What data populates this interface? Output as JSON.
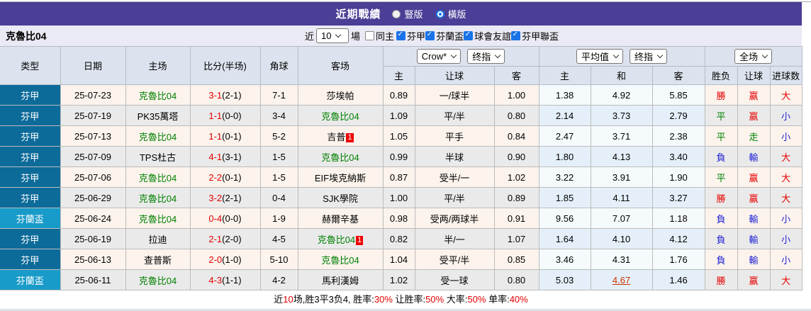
{
  "colors": {
    "accent_purple": "#4a3e96",
    "league_regular_bg": "#0d6b9a",
    "league_cup_bg": "#189bc9",
    "win_red": "#e60000",
    "draw_green": "#008000",
    "lose_blue": "#2121d6",
    "checkbox_blue": "#1a73e8"
  },
  "header": {
    "title": "近期戰績",
    "radio_options": [
      {
        "label": "豎版",
        "selected": false
      },
      {
        "label": "橫版",
        "selected": true
      }
    ]
  },
  "filter": {
    "team": "克魯比04",
    "near_label": "近",
    "count_value": "10",
    "games_label": "場",
    "same_home": {
      "label": "同主",
      "checked": false
    },
    "leagues": [
      {
        "label": "芬甲",
        "checked": true
      },
      {
        "label": "芬蘭盃",
        "checked": true
      },
      {
        "label": "球會友誼",
        "checked": true
      },
      {
        "label": "芬甲聯盃",
        "checked": true
      }
    ]
  },
  "table": {
    "top_headers": [
      "类型",
      "日期",
      "主场",
      "比分(半场)",
      "角球",
      "客场"
    ],
    "selects": {
      "company": "Crow*",
      "company_index": "终指",
      "average": "平均值",
      "average_index": "终指",
      "scope": "全场"
    },
    "sub_headers": [
      "主",
      "让球",
      "客",
      "主",
      "和",
      "客",
      "胜负",
      "让球",
      "进球数"
    ],
    "rows": [
      {
        "league": "芬甲",
        "league_style": "reg",
        "date": "25-07-23",
        "home": "克魯比04",
        "home_green": true,
        "home_card": "",
        "score": "3-1",
        "half": "(2-1)",
        "corner": "7-1",
        "away": "莎埃帕",
        "away_green": false,
        "away_card": "",
        "odds_home": "0.89",
        "handicap": "一/球半",
        "odds_away": "1.00",
        "avg_home": "1.38",
        "avg_draw": "4.92",
        "avg_away": "5.85",
        "avg_draw_hot": false,
        "result": "勝",
        "result_c": "red",
        "let_result": "赢",
        "let_c": "red",
        "goal_result": "大",
        "goal_c": "red"
      },
      {
        "league": "芬甲",
        "league_style": "reg",
        "date": "25-07-19",
        "home": "PK35萬塔",
        "home_green": false,
        "home_card": "",
        "score": "1-1",
        "half": "(0-0)",
        "corner": "3-4",
        "away": "克魯比04",
        "away_green": true,
        "away_card": "",
        "odds_home": "1.09",
        "handicap": "平/半",
        "odds_away": "0.80",
        "avg_home": "2.14",
        "avg_draw": "3.73",
        "avg_away": "2.79",
        "avg_draw_hot": false,
        "result": "平",
        "result_c": "green",
        "let_result": "赢",
        "let_c": "red",
        "goal_result": "小",
        "goal_c": "blue"
      },
      {
        "league": "芬甲",
        "league_style": "reg",
        "date": "25-07-13",
        "home": "克魯比04",
        "home_green": true,
        "home_card": "",
        "score": "1-1",
        "half": "(0-1)",
        "corner": "5-2",
        "away": "吉普",
        "away_green": false,
        "away_card": "1",
        "odds_home": "1.05",
        "handicap": "平手",
        "odds_away": "0.84",
        "avg_home": "2.47",
        "avg_draw": "3.71",
        "avg_away": "2.38",
        "avg_draw_hot": false,
        "result": "平",
        "result_c": "green",
        "let_result": "走",
        "let_c": "green",
        "goal_result": "小",
        "goal_c": "blue"
      },
      {
        "league": "芬甲",
        "league_style": "reg",
        "date": "25-07-09",
        "home": "TPS杜古",
        "home_green": false,
        "home_card": "",
        "score": "4-1",
        "half": "(3-1)",
        "corner": "1-5",
        "away": "克魯比04",
        "away_green": true,
        "away_card": "",
        "odds_home": "0.99",
        "handicap": "半球",
        "odds_away": "0.90",
        "avg_home": "1.80",
        "avg_draw": "4.13",
        "avg_away": "3.40",
        "avg_draw_hot": false,
        "result": "負",
        "result_c": "blue",
        "let_result": "輸",
        "let_c": "blue",
        "goal_result": "大",
        "goal_c": "red"
      },
      {
        "league": "芬甲",
        "league_style": "reg",
        "date": "25-07-06",
        "home": "克魯比04",
        "home_green": true,
        "home_card": "",
        "score": "2-2",
        "half": "(0-1)",
        "corner": "1-5",
        "away": "EIF埃克納斯",
        "away_green": false,
        "away_card": "",
        "odds_home": "0.87",
        "handicap": "受半/一",
        "odds_away": "1.02",
        "avg_home": "3.22",
        "avg_draw": "3.91",
        "avg_away": "1.90",
        "avg_draw_hot": false,
        "result": "平",
        "result_c": "green",
        "let_result": "赢",
        "let_c": "red",
        "goal_result": "大",
        "goal_c": "red"
      },
      {
        "league": "芬甲",
        "league_style": "reg",
        "date": "25-06-29",
        "home": "克魯比04",
        "home_green": true,
        "home_card": "",
        "score": "3-2",
        "half": "(2-1)",
        "corner": "0-4",
        "away": "SJK學院",
        "away_green": false,
        "away_card": "",
        "odds_home": "1.00",
        "handicap": "平/半",
        "odds_away": "0.89",
        "avg_home": "1.85",
        "avg_draw": "4.11",
        "avg_away": "3.27",
        "avg_draw_hot": false,
        "result": "勝",
        "result_c": "red",
        "let_result": "赢",
        "let_c": "red",
        "goal_result": "大",
        "goal_c": "red"
      },
      {
        "league": "芬蘭盃",
        "league_style": "cup",
        "date": "25-06-24",
        "home": "克魯比04",
        "home_green": true,
        "home_card": "",
        "score": "0-4",
        "half": "(0-0)",
        "corner": "1-9",
        "away": "赫爾辛基",
        "away_green": false,
        "away_card": "",
        "odds_home": "0.98",
        "handicap": "受两/两球半",
        "odds_away": "0.91",
        "avg_home": "9.56",
        "avg_draw": "7.07",
        "avg_away": "1.18",
        "avg_draw_hot": false,
        "result": "負",
        "result_c": "blue",
        "let_result": "輸",
        "let_c": "blue",
        "goal_result": "小",
        "goal_c": "blue"
      },
      {
        "league": "芬甲",
        "league_style": "reg",
        "date": "25-06-19",
        "home": "拉迪",
        "home_green": false,
        "home_card": "",
        "score": "2-1",
        "half": "(2-0)",
        "corner": "4-5",
        "away": "克魯比04",
        "away_green": true,
        "away_card": "1",
        "odds_home": "0.82",
        "handicap": "半/一",
        "odds_away": "1.07",
        "avg_home": "1.64",
        "avg_draw": "4.10",
        "avg_away": "4.12",
        "avg_draw_hot": false,
        "result": "負",
        "result_c": "blue",
        "let_result": "輸",
        "let_c": "blue",
        "goal_result": "小",
        "goal_c": "blue"
      },
      {
        "league": "芬甲",
        "league_style": "reg",
        "date": "25-06-13",
        "home": "查普斯",
        "home_green": false,
        "home_card": "",
        "score": "2-0",
        "half": "(1-0)",
        "corner": "5-10",
        "away": "克魯比04",
        "away_green": true,
        "away_card": "",
        "odds_home": "1.04",
        "handicap": "受平/半",
        "odds_away": "0.85",
        "avg_home": "3.46",
        "avg_draw": "4.31",
        "avg_away": "1.76",
        "avg_draw_hot": false,
        "result": "負",
        "result_c": "blue",
        "let_result": "輸",
        "let_c": "blue",
        "goal_result": "小",
        "goal_c": "blue"
      },
      {
        "league": "芬蘭盃",
        "league_style": "cup",
        "date": "25-06-11",
        "home": "克魯比04",
        "home_green": true,
        "home_card": "",
        "score": "4-3",
        "half": "(1-1)",
        "corner": "4-2",
        "away": "馬利漢姆",
        "away_green": false,
        "away_card": "",
        "odds_home": "1.02",
        "handicap": "受一球",
        "odds_away": "0.80",
        "avg_home": "5.03",
        "avg_draw": "4.67",
        "avg_away": "1.46",
        "avg_draw_hot": true,
        "result": "勝",
        "result_c": "red",
        "let_result": "赢",
        "let_c": "red",
        "goal_result": "大",
        "goal_c": "red"
      }
    ]
  },
  "summary": {
    "segments": [
      {
        "text": "近",
        "red": false
      },
      {
        "text": "10",
        "red": true
      },
      {
        "text": "场,胜3平3负4, 胜率:",
        "red": false
      },
      {
        "text": "30%",
        "red": true
      },
      {
        "text": " 让胜率:",
        "red": false
      },
      {
        "text": "50%",
        "red": true
      },
      {
        "text": " 大率:",
        "red": false
      },
      {
        "text": "50%",
        "red": true
      },
      {
        "text": " 单率:",
        "red": false
      },
      {
        "text": "40%",
        "red": true
      }
    ]
  }
}
